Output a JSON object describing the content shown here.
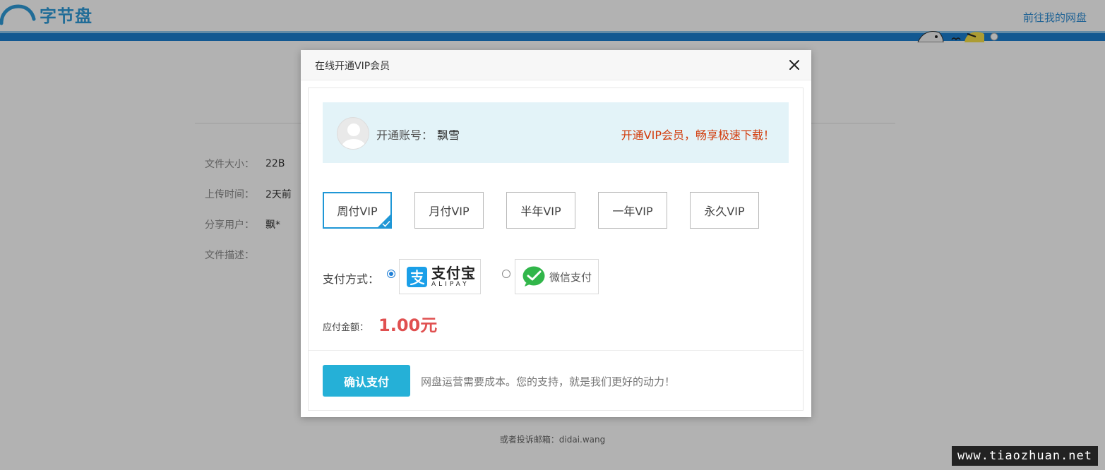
{
  "header": {
    "logo_text": "字节盘",
    "goto_link": "前往我的网盘"
  },
  "file_info": [
    {
      "label": "文件大小：",
      "value": "22B"
    },
    {
      "label": "上传时间：",
      "value": "2天前"
    },
    {
      "label": "分享用户：",
      "value": "飘*"
    },
    {
      "label": "文件描述：",
      "value": ""
    }
  ],
  "footer": {
    "text": "或者投诉邮箱：didai.wang"
  },
  "watermark": "www.tiaozhuan.net",
  "modal": {
    "title": "在线开通VIP会员",
    "account": {
      "label": "开通账号：",
      "name": "飘雪",
      "promo": "开通VIP会员，畅享极速下载！"
    },
    "plans": [
      {
        "label": "周付VIP",
        "selected": true
      },
      {
        "label": "月付VIP",
        "selected": false
      },
      {
        "label": "半年VIP",
        "selected": false
      },
      {
        "label": "一年VIP",
        "selected": false
      },
      {
        "label": "永久VIP",
        "selected": false
      }
    ],
    "payment": {
      "label": "支付方式：",
      "alipay_cn": "支付宝",
      "alipay_en": "ALIPAY",
      "wechat": "微信支付",
      "selected": "alipay"
    },
    "amount": {
      "label": "应付金额：",
      "value": "1.00元"
    },
    "confirm_label": "确认支付",
    "support_text": "网盘运营需要成本。您的支持，就是我们更好的动力！"
  },
  "colors": {
    "accent": "#1f97d6",
    "button": "#25b0d7",
    "promo": "#d23c0c",
    "price": "#e05050",
    "header_bar": "#1a7fd0"
  }
}
